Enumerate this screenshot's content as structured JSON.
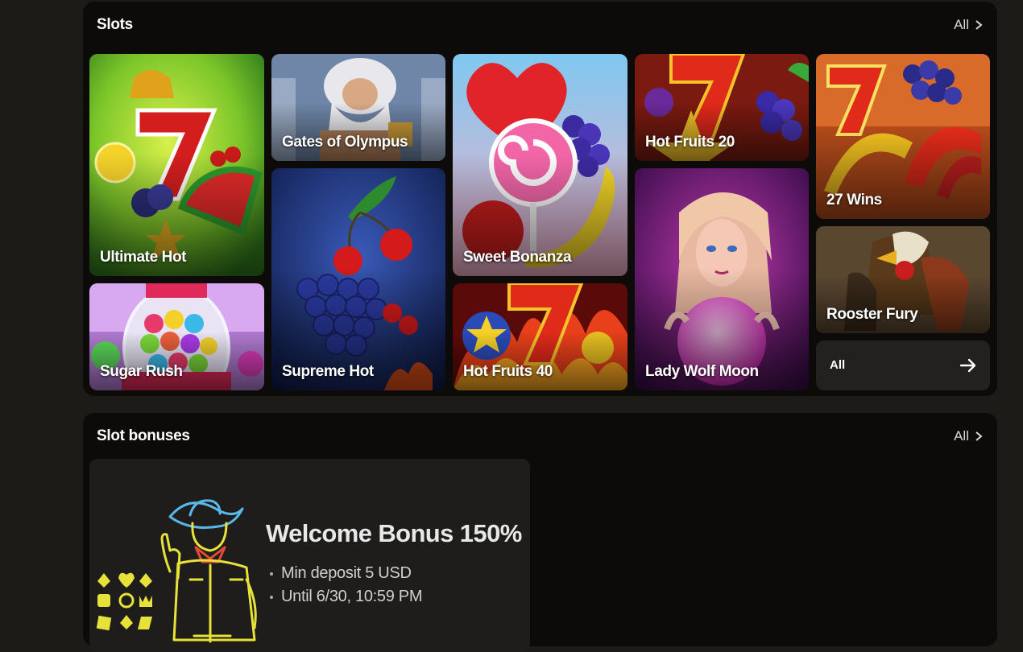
{
  "slots": {
    "title": "Slots",
    "all_label": "All",
    "games": [
      {
        "name": "Ultimate Hot"
      },
      {
        "name": "Gates of Olympus"
      },
      {
        "name": "Sweet Bonanza"
      },
      {
        "name": "Hot Fruits 20"
      },
      {
        "name": "27 Wins"
      },
      {
        "name": "Sugar Rush"
      },
      {
        "name": "Supreme Hot"
      },
      {
        "name": "Hot Fruits 40"
      },
      {
        "name": "Lady Wolf Moon"
      },
      {
        "name": "Rooster Fury"
      }
    ],
    "all_tile_label": "All"
  },
  "bonuses": {
    "title": "Slot bonuses",
    "all_label": "All",
    "card": {
      "title": "Welcome Bonus 150%",
      "details": [
        "Min deposit 5 USD",
        "Until 6/30, 10:59 PM"
      ]
    }
  },
  "colors": {
    "background": "#1c1b18",
    "panel": "#0c0b0a",
    "card": "#1e1d1b",
    "neon_accent": "#e6e23a"
  },
  "icons": [
    "chevron-right-icon",
    "arrow-right-icon",
    "cowboy-neon-illustration",
    "card-suits-icon"
  ]
}
